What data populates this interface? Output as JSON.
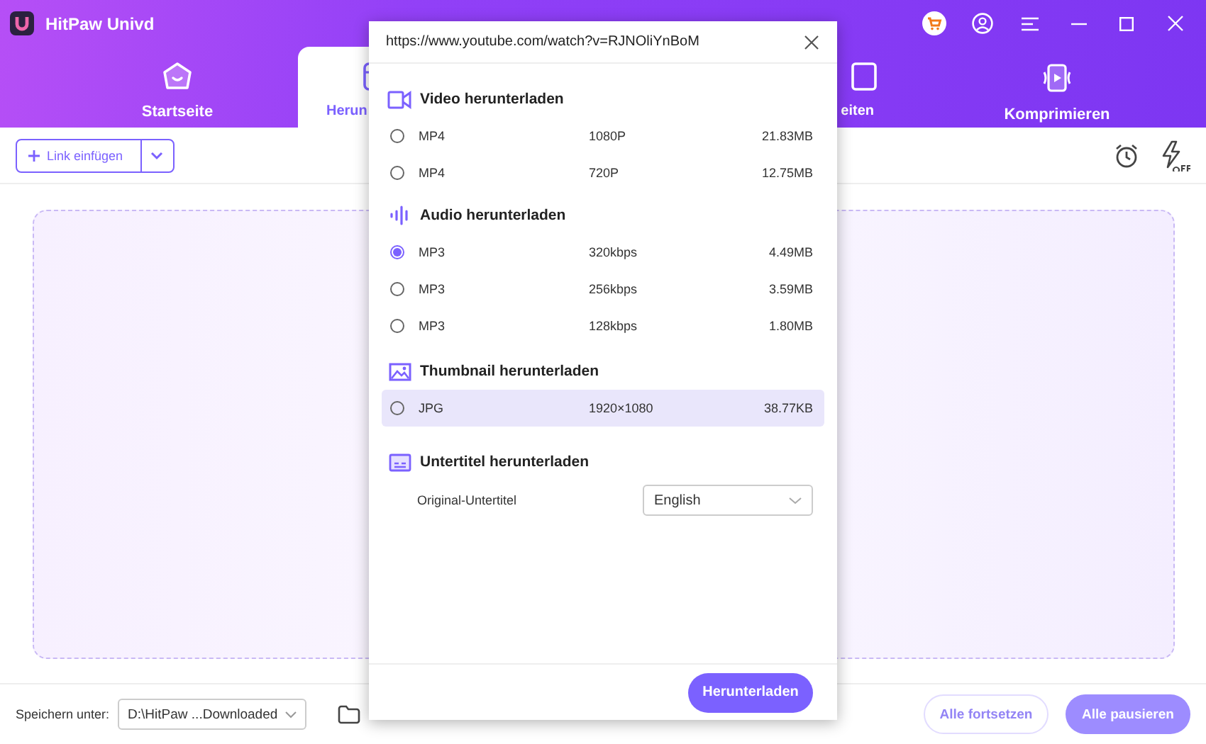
{
  "app": {
    "title": "HitPaw Univd"
  },
  "tabs": [
    {
      "label": "Startseite",
      "selected": false
    },
    {
      "label": "Herun",
      "selected": true
    },
    {
      "label": "eiten",
      "selected": false
    },
    {
      "label": "Komprimieren",
      "selected": false
    }
  ],
  "toolbar": {
    "paste_button": "Link einfügen"
  },
  "dialog": {
    "url": "https://www.youtube.com/watch?v=RJNOliYnBoM",
    "sections": [
      {
        "kind": "video",
        "title": "Video herunterladen",
        "options": [
          {
            "format": "MP4",
            "quality": "1080P",
            "size": "21.83MB",
            "selected": false,
            "highlighted": false
          },
          {
            "format": "MP4",
            "quality": "720P",
            "size": "12.75MB",
            "selected": false,
            "highlighted": false
          }
        ]
      },
      {
        "kind": "audio",
        "title": "Audio herunterladen",
        "options": [
          {
            "format": "MP3",
            "quality": "320kbps",
            "size": "4.49MB",
            "selected": true,
            "highlighted": false
          },
          {
            "format": "MP3",
            "quality": "256kbps",
            "size": "3.59MB",
            "selected": false,
            "highlighted": false
          },
          {
            "format": "MP3",
            "quality": "128kbps",
            "size": "1.80MB",
            "selected": false,
            "highlighted": false
          }
        ]
      },
      {
        "kind": "image",
        "title": "Thumbnail herunterladen",
        "options": [
          {
            "format": "JPG",
            "quality": "1920×1080",
            "size": "38.77KB",
            "selected": false,
            "highlighted": true
          }
        ]
      },
      {
        "kind": "subtitle",
        "title": "Untertitel herunterladen",
        "label": "Original-Untertitel",
        "value": "English"
      }
    ],
    "download_button": "Herunterladen"
  },
  "bottom": {
    "save_label": "Speichern unter:",
    "path": "D:\\HitPaw ...Downloaded",
    "buttons": [
      {
        "label": "Alle fortsetzen",
        "kind": "outline",
        "disabled": true
      },
      {
        "label": "Alle pausieren",
        "kind": "filled",
        "disabled": true
      }
    ]
  }
}
